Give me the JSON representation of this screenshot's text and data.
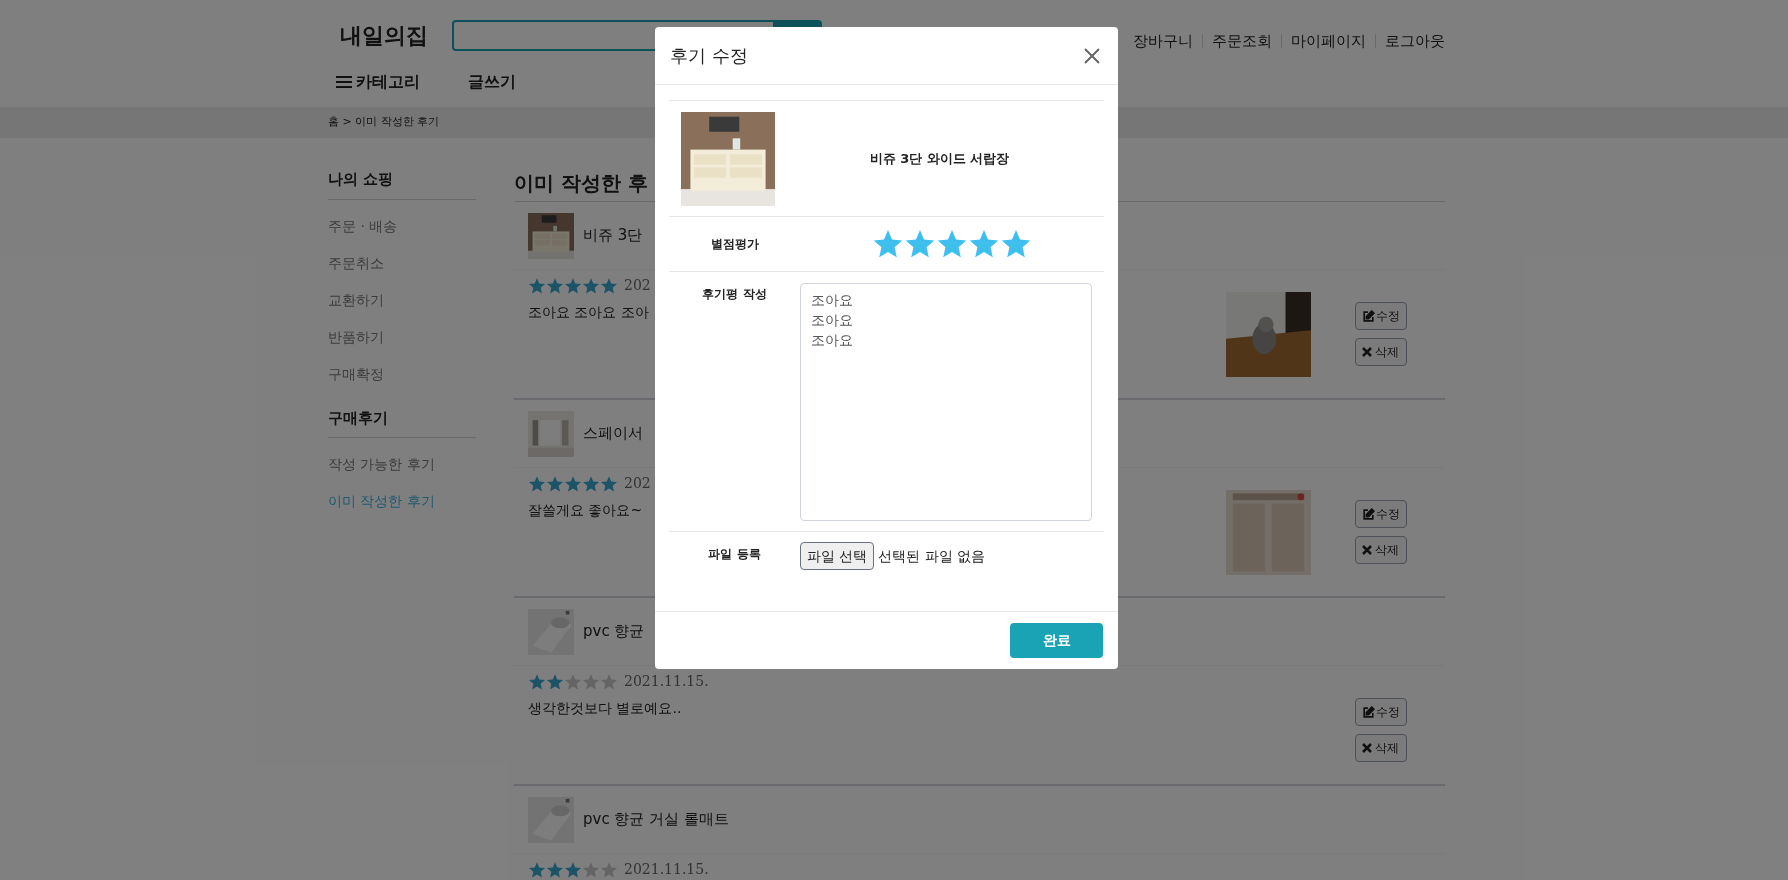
{
  "header": {
    "logo": "내일의집",
    "links": [
      "장바구니",
      "주문조회",
      "마이페이지",
      "로그아웃"
    ]
  },
  "nav": {
    "category": "카테고리",
    "write": "글쓰기"
  },
  "breadcrumb": "홈 > 이미 작성한 후기",
  "sidebar": {
    "sections": [
      {
        "title": "나의 쇼핑",
        "items": [
          {
            "label": "주문 · 배송",
            "selected": false
          },
          {
            "label": "주문취소",
            "selected": false
          },
          {
            "label": "교환하기",
            "selected": false
          },
          {
            "label": "반품하기",
            "selected": false
          },
          {
            "label": "구매확정",
            "selected": false
          }
        ]
      },
      {
        "title": "구매후기",
        "items": [
          {
            "label": "작성 가능한 후기",
            "selected": false
          },
          {
            "label": "이미 작성한 후기",
            "selected": true
          }
        ]
      }
    ]
  },
  "page_title": "이미 작성한 후",
  "reviews": [
    {
      "product": "비쥬 3단",
      "stars": 5,
      "date": "202",
      "text": "조아요 조아요 조아",
      "edit": "수정",
      "delete": "삭제"
    },
    {
      "product": "스페이서",
      "stars": 5,
      "date": "202",
      "text": "잘쓸게요 좋아요~",
      "edit": "수정",
      "delete": "삭제"
    },
    {
      "product": "pvc 향균",
      "stars": 2,
      "date": "2021.11.15.",
      "text": "생각한것보다 별로예요..",
      "edit": "수정",
      "delete": "삭제"
    },
    {
      "product": "pvc 향균 거실 롤매트",
      "stars": 3,
      "date": "2021.11.15."
    }
  ],
  "modal": {
    "title": "후기 수정",
    "product": "비쥬 3단 와이드 서랍장",
    "rating_label": "별점평가",
    "stars": 5,
    "review_label": "후기평 작성",
    "review_value": "조아요\n조아요\n조아요",
    "file_label": "파일 등록",
    "file_button": "파일 선택",
    "file_status": "선택된 파일 없음",
    "submit": "완료"
  }
}
